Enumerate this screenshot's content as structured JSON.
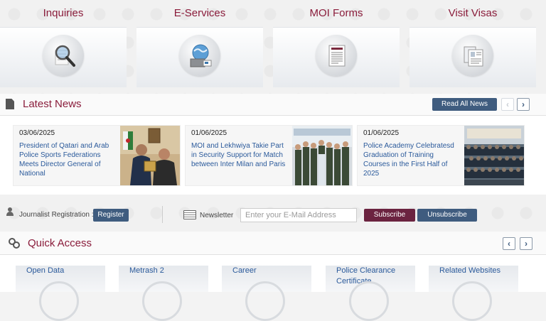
{
  "services": [
    {
      "label": "Inquiries",
      "icon": "magnifier-icon"
    },
    {
      "label": "E-Services",
      "icon": "globe-laptop-icon"
    },
    {
      "label": "MOI Forms",
      "icon": "forms-document-icon"
    },
    {
      "label": "Visit Visas",
      "icon": "visa-document-icon"
    }
  ],
  "news": {
    "title": "Latest News",
    "read_all": "Read All News",
    "items": [
      {
        "date": "03/06/2025",
        "text": "President of Qatari and Arab Police Sports Federations Meets Director General of National"
      },
      {
        "date": "01/06/2025",
        "text": "MOI and Lekhwiya Takie Part in Security Support for Match between Inter Milan and Paris"
      },
      {
        "date": "01/06/2025",
        "text": "Police Academy Celebratesd Graduation of Training Courses in the First Half of 2025"
      }
    ]
  },
  "registration": {
    "journalist_label": "Journalist Registration :",
    "register_btn": "Register",
    "newsletter_label": "Newsletter",
    "email_placeholder": "Enter your E-Mail Address",
    "subscribe_btn": "Subscribe",
    "unsubscribe_btn": "Unsubscribe"
  },
  "quick_access": {
    "title": "Quick Access",
    "tiles": [
      {
        "label": "Open Data"
      },
      {
        "label": "Metrash 2"
      },
      {
        "label": "Career"
      },
      {
        "label": "Police Clearance Certificate"
      },
      {
        "label": "Related Websites"
      }
    ]
  },
  "colors": {
    "accent": "#8a1c3b",
    "button_blue": "#3f5c7f",
    "button_maroon": "#6b2340",
    "link": "#2b5a9b"
  }
}
